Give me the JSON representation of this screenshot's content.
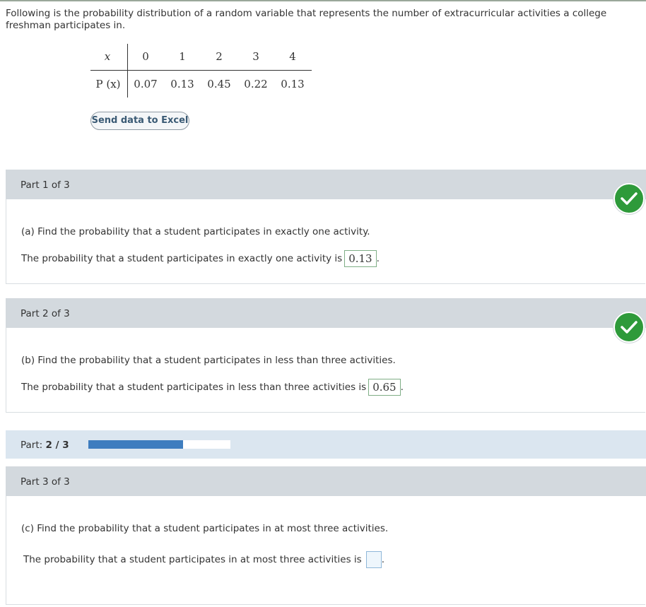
{
  "intro": "Following is the probability distribution of a random variable that represents the number of extracurricular activities a college freshman participates in.",
  "table": {
    "x_label": "x",
    "p_label": "P (x)",
    "x_values": [
      "0",
      "1",
      "2",
      "3",
      "4"
    ],
    "p_values": [
      "0.07",
      "0.13",
      "0.45",
      "0.22",
      "0.13"
    ]
  },
  "excel_button": "Send data to Excel",
  "part1": {
    "header": "Part 1 of 3",
    "question": "(a) Find the probability that a student participates in exactly one activity.",
    "answer_prefix": "The probability that a student participates in exactly one activity is",
    "answer": "0.13",
    "status_icon": "check-icon"
  },
  "part2": {
    "header": "Part 2 of 3",
    "question": "(b) Find the probability that a student participates in less than three activities.",
    "answer_prefix": "The probability that a student participates in less than three activities is",
    "answer": "0.65",
    "status_icon": "check-icon"
  },
  "progress": {
    "label": "Part:",
    "value": "2 / 3",
    "fraction": 0.6667
  },
  "part3": {
    "header": "Part 3 of 3",
    "question": "(c) Find the probability that a student participates in at most three activities.",
    "answer_prefix": "The probability that a student participates in at most three activities is",
    "answer": ""
  },
  "period": ".",
  "colors": {
    "check_green": "#2e9a3a",
    "progress_fill": "#3e7dbf",
    "header_gray": "#d3d9de"
  }
}
